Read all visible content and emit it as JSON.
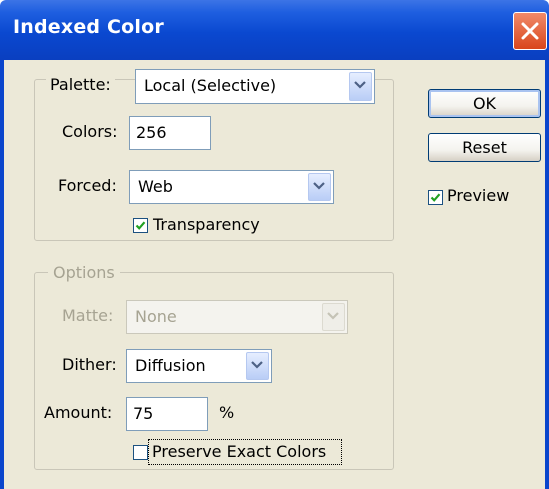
{
  "window": {
    "title": "Indexed Color"
  },
  "palette": {
    "label": "Palette:",
    "value": "Local (Selective)"
  },
  "colors": {
    "label": "Colors:",
    "value": "256"
  },
  "forced": {
    "label": "Forced:",
    "value": "Web"
  },
  "transparency": {
    "label": "Transparency",
    "checked": true
  },
  "options": {
    "legend": "Options",
    "matte": {
      "label": "Matte:",
      "value": "None",
      "disabled": true
    },
    "dither": {
      "label": "Dither:",
      "value": "Diffusion"
    },
    "amount": {
      "label": "Amount:",
      "value": "75",
      "unit": "%"
    },
    "preserve": {
      "label": "Preserve Exact Colors",
      "checked": false
    }
  },
  "buttons": {
    "ok": "OK",
    "reset": "Reset"
  },
  "preview": {
    "label": "Preview",
    "checked": true
  },
  "colors_theme": {
    "title_bar": "#0a48d0",
    "dialog_bg": "#ece9d8",
    "check": "#21a121",
    "close_button": "#d9461c"
  }
}
